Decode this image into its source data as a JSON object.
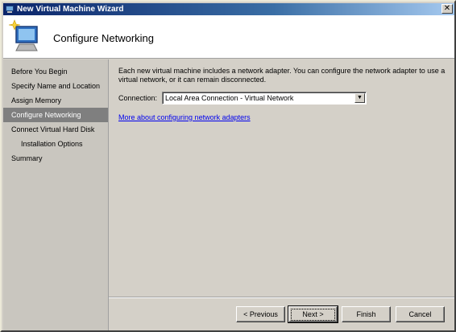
{
  "window": {
    "title": "New Virtual Machine Wizard",
    "close_glyph": "✕"
  },
  "header": {
    "title": "Configure Networking",
    "icon": "wizard-computer-icon"
  },
  "sidebar": {
    "items": [
      {
        "label": "Before You Begin",
        "active": false
      },
      {
        "label": "Specify Name and Location",
        "active": false
      },
      {
        "label": "Assign Memory",
        "active": false
      },
      {
        "label": "Configure Networking",
        "active": true
      },
      {
        "label": "Connect Virtual Hard Disk",
        "active": false
      },
      {
        "label": "Installation Options",
        "active": false
      },
      {
        "label": "Summary",
        "active": false
      }
    ]
  },
  "main": {
    "description": "Each new virtual machine includes a network adapter. You can configure the network adapter to use a virtual network, or it can remain disconnected.",
    "connection_label": "Connection:",
    "connection_value": "Local Area Connection - Virtual Network",
    "more_link": "More about configuring network adapters"
  },
  "buttons": {
    "previous": "< Previous",
    "next": "Next >",
    "finish": "Finish",
    "cancel": "Cancel"
  },
  "colors": {
    "titlebar": "#0a246a",
    "active_nav": "#7f7f7f",
    "link": "#0000ee"
  }
}
